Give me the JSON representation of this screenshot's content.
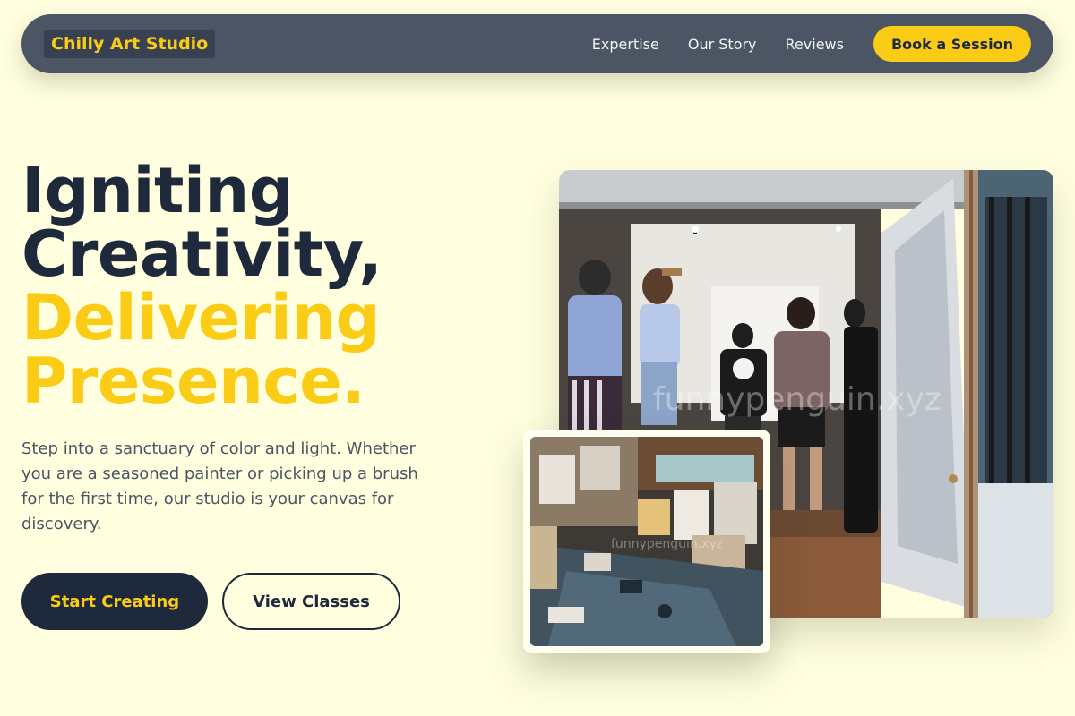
{
  "nav": {
    "logo": "Chilly Art Studio",
    "links": [
      "Expertise",
      "Our Story",
      "Reviews"
    ],
    "cta": "Book a Session"
  },
  "hero": {
    "title_line1": "Igniting",
    "title_line2": "Creativity,",
    "title_line3": "Delivering",
    "title_line4": "Presence.",
    "description": "Step into a sanctuary of color and light. Whether you are a seasoned painter or picking up a brush for the first time, our studio is your canvas for discovery.",
    "primary_button": "Start Creating",
    "secondary_button": "View Classes"
  },
  "images": {
    "main_watermark": "funnypenguin.xyz",
    "small_watermark": "funnypenguin.xyz"
  },
  "colors": {
    "background": "#ffffe0",
    "nav_bg": "#4b5563",
    "accent": "#facc15",
    "dark": "#1e293b"
  }
}
